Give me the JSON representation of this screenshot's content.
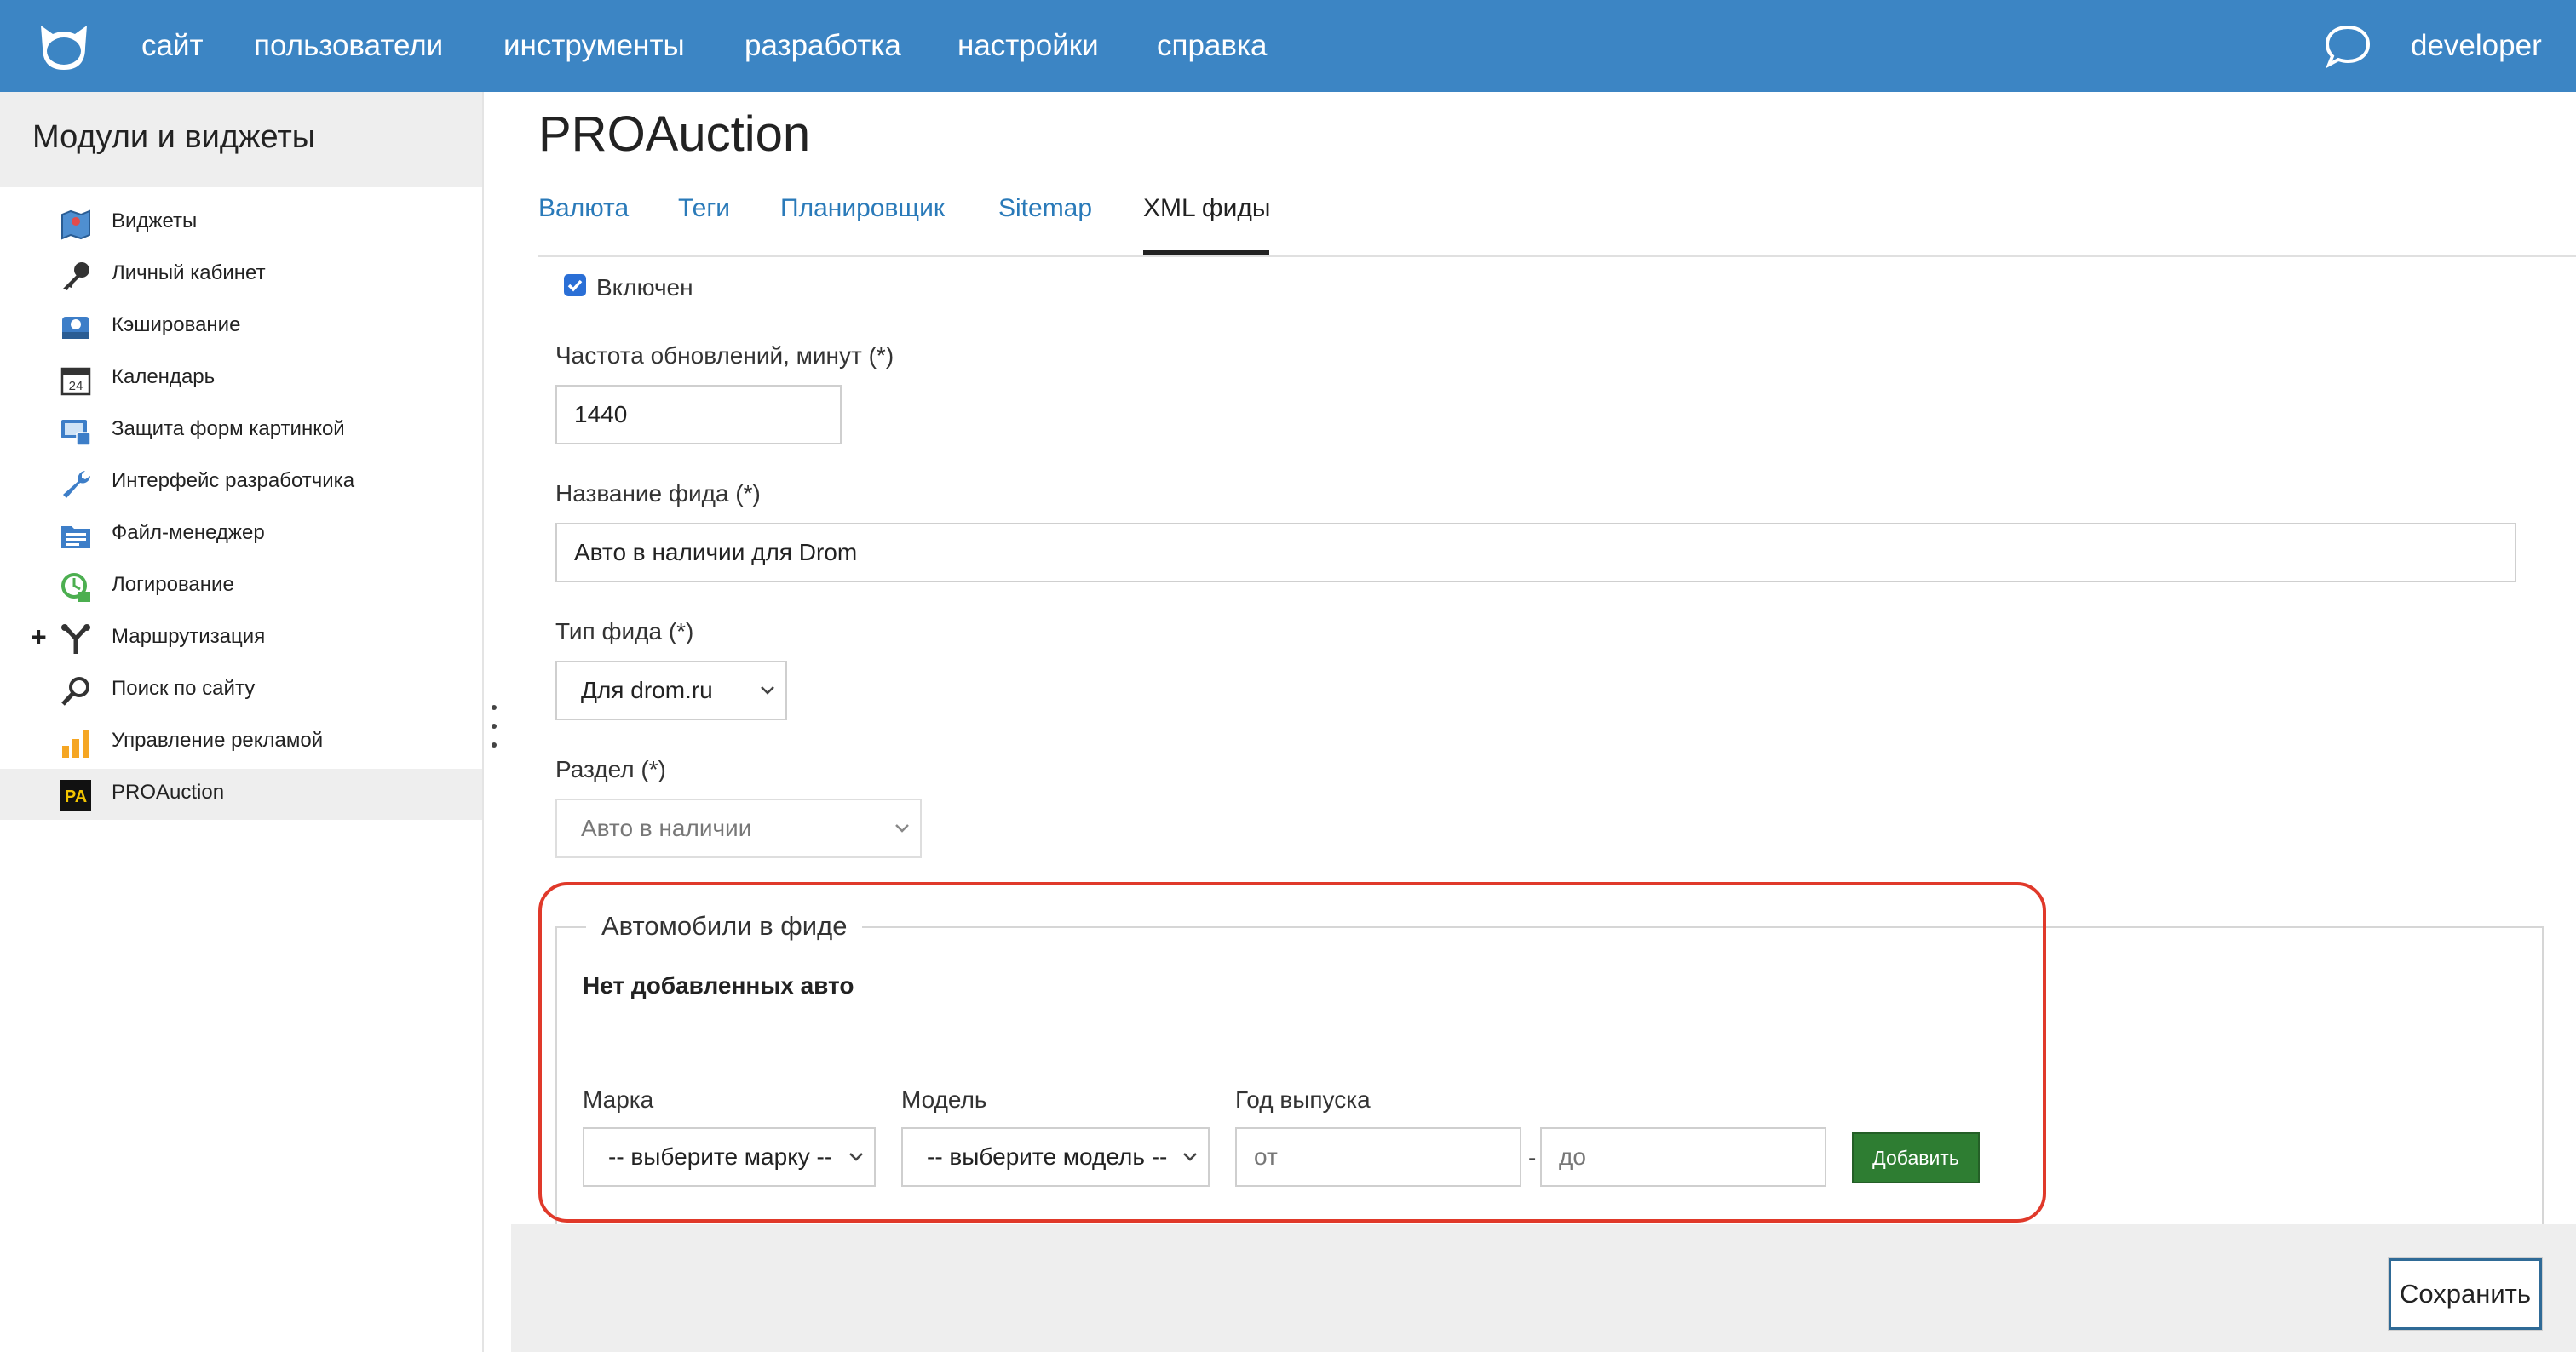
{
  "topnav": {
    "items": [
      "сайт",
      "пользователи",
      "инструменты",
      "разработка",
      "настройки",
      "справка"
    ],
    "user": "developer",
    "icons": {
      "logo": "cat-logo-icon",
      "chat": "chat-bubble-icon"
    },
    "background": "#3c85c4"
  },
  "sidebar": {
    "title": "Модули и виджеты",
    "items": [
      {
        "label": "Виджеты",
        "icon": "map-icon"
      },
      {
        "label": "Личный кабинет",
        "icon": "key-icon"
      },
      {
        "label": "Кэширование",
        "icon": "hard-drive-icon"
      },
      {
        "label": "Календарь",
        "icon": "calendar-icon"
      },
      {
        "label": "Защита форм картинкой",
        "icon": "captcha-icon"
      },
      {
        "label": "Интерфейс разработчика",
        "icon": "wrench-icon"
      },
      {
        "label": "Файл-менеджер",
        "icon": "folder-icon"
      },
      {
        "label": "Логирование",
        "icon": "log-icon"
      },
      {
        "label": "Маршрутизация",
        "icon": "routing-icon",
        "expand": "+"
      },
      {
        "label": "Поиск по сайту",
        "icon": "magnifier-icon"
      },
      {
        "label": "Управление рекламой",
        "icon": "bar-chart-icon"
      },
      {
        "label": "PROAuction",
        "icon": "pa-logo-icon",
        "logo_text": "PA",
        "active": true
      }
    ]
  },
  "main": {
    "title": "PROAuction",
    "tabs": [
      {
        "label": "Валюта"
      },
      {
        "label": "Теги"
      },
      {
        "label": "Планировщик"
      },
      {
        "label": "Sitemap"
      },
      {
        "label": "XML фиды",
        "active": true
      }
    ],
    "form": {
      "enabled_label": "Включен",
      "enabled": true,
      "update_freq_label": "Частота обновлений, минут (*)",
      "update_freq_value": "1440",
      "feed_name_label": "Название фида (*)",
      "feed_name_value": "Авто в наличии для Drom",
      "feed_type_label": "Тип фида (*)",
      "feed_type_value": "Для drom.ru",
      "section_label": "Раздел (*)",
      "section_value": "Авто в наличии"
    },
    "cars": {
      "legend": "Автомобили в фиде",
      "empty_text": "Нет добавленных авто",
      "brand_label": "Марка",
      "brand_value": "-- выберите марку --",
      "model_label": "Модель",
      "model_value": "-- выберите модель --",
      "year_label": "Год выпуска",
      "year_from_placeholder": "от",
      "year_separator": "-",
      "year_to_placeholder": "до",
      "add_button": "Добавить"
    },
    "save_button": "Сохранить"
  },
  "colors": {
    "accent": "#3c85c4",
    "link": "#2a7ab9",
    "add_button": "#2e7d32",
    "highlight": "#e0392a"
  }
}
